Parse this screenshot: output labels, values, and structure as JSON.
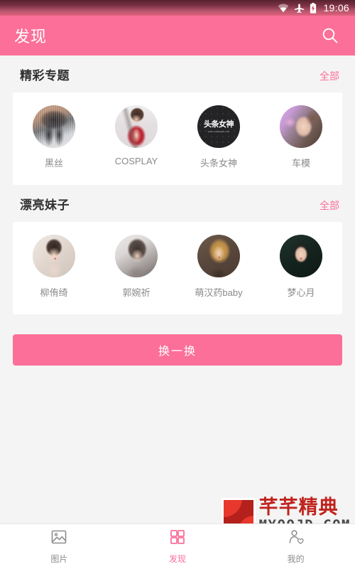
{
  "statusbar": {
    "time": "19:06",
    "icons": [
      "wifi-icon",
      "airplane-mode-icon",
      "battery-charging-icon"
    ]
  },
  "appbar": {
    "title": "发现",
    "search_icon": "search-icon"
  },
  "sections": [
    {
      "title": "精彩专题",
      "more_label": "全部",
      "items": [
        {
          "label": "黑丝",
          "avatar_kind": "photo-stockings"
        },
        {
          "label": "COSPLAY",
          "avatar_kind": "photo-cosplay"
        },
        {
          "label": "头条女神",
          "avatar_kind": "logo-dark",
          "logo_text": "头条女神",
          "logo_sub": "www.toutiaogirl.com"
        },
        {
          "label": "车模",
          "avatar_kind": "photo-carmodel"
        }
      ]
    },
    {
      "title": "漂亮妹子",
      "more_label": "全部",
      "items": [
        {
          "label": "柳侑绮",
          "avatar_kind": "photo-girl-1"
        },
        {
          "label": "郭婉祈",
          "avatar_kind": "photo-girl-2"
        },
        {
          "label": "萌汉药baby",
          "avatar_kind": "photo-girl-3"
        },
        {
          "label": "梦心月",
          "avatar_kind": "photo-girl-4"
        }
      ]
    }
  ],
  "refresh": {
    "label": "换一换"
  },
  "watermark": {
    "cn": "芊芊精典",
    "en": "MYQQJD.COM"
  },
  "bottomnav": {
    "items": [
      {
        "label": "图片",
        "icon": "image-icon",
        "active": false
      },
      {
        "label": "发现",
        "icon": "grid-icon",
        "active": true
      },
      {
        "label": "我的",
        "icon": "profile-heart-icon",
        "active": false
      }
    ]
  },
  "colors": {
    "accent": "#fc6f99",
    "page_bg": "#f4f4f4",
    "card_bg": "#ffffff",
    "title_text": "#303030",
    "label_text": "#8a8a8a",
    "nav_inactive": "#8c8c8c",
    "watermark_red": "#c0231d"
  }
}
